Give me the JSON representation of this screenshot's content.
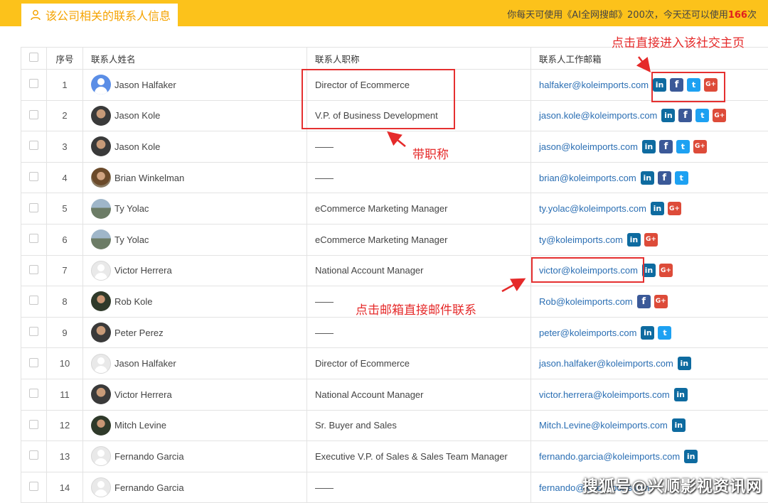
{
  "header": {
    "tab_label": "该公司相关的联系人信息",
    "quota_prefix": "你每天可使用《AI全网搜邮》200次，今天还可以使用",
    "quota_remaining": "166",
    "quota_suffix": "次",
    "accent_color": "#fcc21b",
    "tab_icon": "user-icon"
  },
  "table": {
    "columns": [
      "",
      "序号",
      "联系人姓名",
      "联系人职称",
      "联系人工作邮箱"
    ],
    "rows": [
      {
        "no": "1",
        "name": "Jason Halfaker",
        "avatar": "default-blue",
        "title": "Director of Ecommerce",
        "email": "halfaker@koleimports.com",
        "social": [
          "in",
          "fb",
          "tw",
          "gp"
        ]
      },
      {
        "no": "2",
        "name": "Jason Kole",
        "avatar": "photo",
        "title": "V.P. of Business Development",
        "email": "jason.kole@koleimports.com",
        "social": [
          "in",
          "fb",
          "tw",
          "gp"
        ]
      },
      {
        "no": "3",
        "name": "Jason Kole",
        "avatar": "photo",
        "title": "——",
        "email": "jason@koleimports.com",
        "social": [
          "in",
          "fb",
          "tw",
          "gp"
        ]
      },
      {
        "no": "4",
        "name": "Brian Winkelman",
        "avatar": "photo2",
        "title": "——",
        "email": "brian@koleimports.com",
        "social": [
          "in",
          "fb",
          "tw"
        ]
      },
      {
        "no": "5",
        "name": "Ty Yolac",
        "avatar": "house",
        "title": "eCommerce Marketing Manager",
        "email": "ty.yolac@koleimports.com",
        "social": [
          "in",
          "gp"
        ]
      },
      {
        "no": "6",
        "name": "Ty Yolac",
        "avatar": "house",
        "title": "eCommerce Marketing Manager",
        "email": "ty@koleimports.com",
        "social": [
          "in",
          "gp"
        ]
      },
      {
        "no": "7",
        "name": "Victor Herrera",
        "avatar": "default-gray",
        "title": "National Account Manager",
        "email": "victor@koleimports.com",
        "social": [
          "in",
          "gp"
        ]
      },
      {
        "no": "8",
        "name": "Rob Kole",
        "avatar": "face",
        "title": "——",
        "email": "Rob@koleimports.com",
        "social": [
          "fb",
          "gp"
        ]
      },
      {
        "no": "9",
        "name": "Peter Perez",
        "avatar": "photo",
        "title": "——",
        "email": "peter@koleimports.com",
        "social": [
          "in",
          "tw"
        ]
      },
      {
        "no": "10",
        "name": "Jason Halfaker",
        "avatar": "default-gray",
        "title": "Director of Ecommerce",
        "email": "jason.halfaker@koleimports.com",
        "social": [
          "in"
        ]
      },
      {
        "no": "11",
        "name": "Victor Herrera",
        "avatar": "photo",
        "title": "National Account Manager",
        "email": "victor.herrera@koleimports.com",
        "social": [
          "in"
        ]
      },
      {
        "no": "12",
        "name": "Mitch Levine",
        "avatar": "face",
        "title": "Sr. Buyer and Sales",
        "email": "Mitch.Levine@koleimports.com",
        "social": [
          "in"
        ]
      },
      {
        "no": "13",
        "name": "Fernando Garcia",
        "avatar": "default-gray",
        "title": "Executive V.P. of Sales & Sales Team Manager",
        "email": "fernando.garcia@koleimports.com",
        "social": [
          "in"
        ]
      },
      {
        "no": "14",
        "name": "Fernando Garcia",
        "avatar": "default-gray",
        "title": "——",
        "email": "fernando@koleimports.com",
        "social": []
      }
    ]
  },
  "annotations": {
    "social_note": "点击直接进入该社交主页",
    "title_note": "带职称",
    "email_note": "点击邮箱直接邮件联系",
    "color": "#e52a2a"
  },
  "watermark": "搜狐号@兴顺影视资讯网"
}
